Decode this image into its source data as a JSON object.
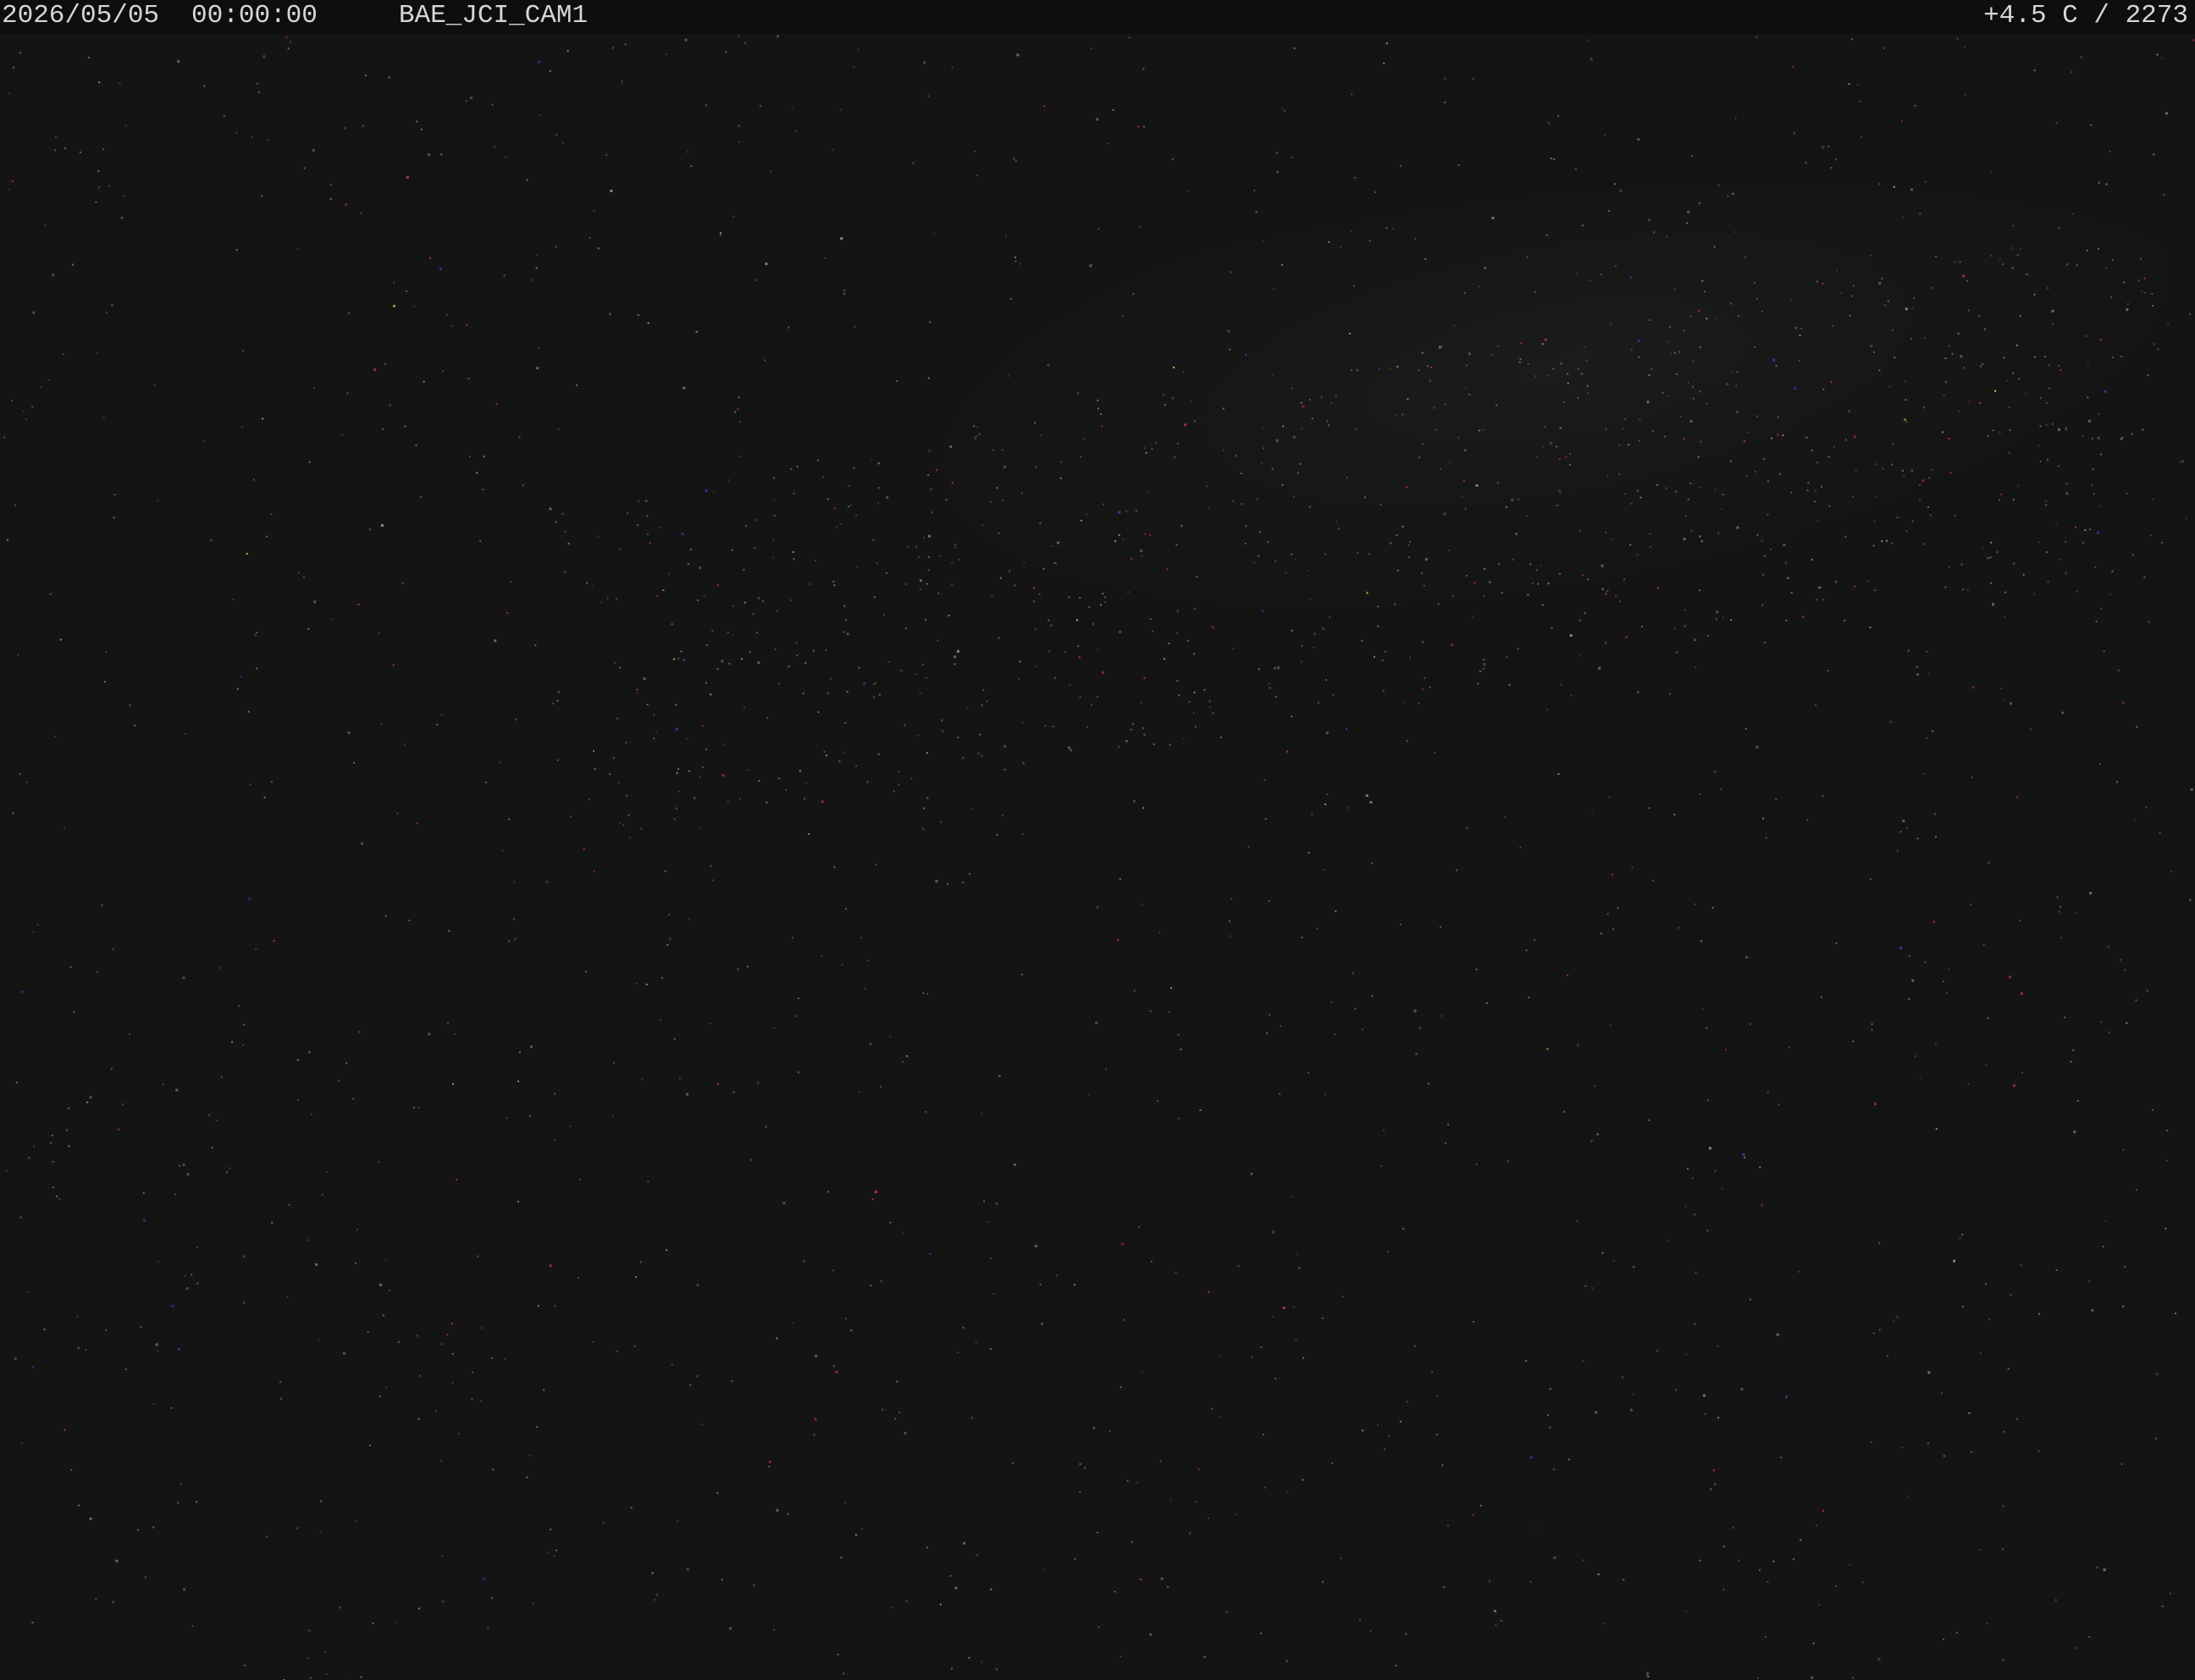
{
  "osd": {
    "date": "2026/05/05",
    "time": "00:00:00",
    "camera_id": "BAE_JCI_CAM1",
    "temperature_readout": "+4.5 C / 2273"
  },
  "scene": {
    "description_kind": "night-sky-camera-frame",
    "background_color": "#141414",
    "osd_bar_color": "#0e0e0e",
    "osd_text_color": "#d6d6d6",
    "star_colors": [
      "#8a8a8a",
      "#b03040",
      "#3040a0",
      "#6a6a6a",
      "#c8c850"
    ]
  }
}
